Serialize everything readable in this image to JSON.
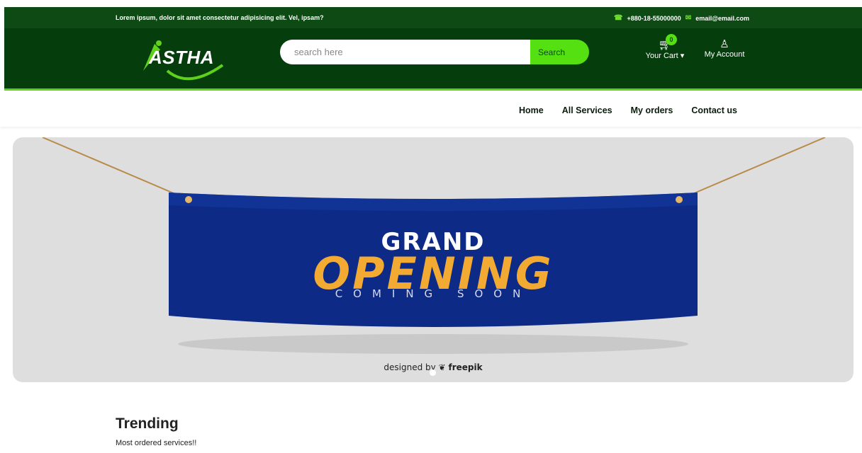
{
  "topbar": {
    "tagline": "Lorem ipsum, dolor sit amet consectetur adipisicing elit. Vel, ipsam?",
    "phone": "+880-18-55000000",
    "email": "email@email.com"
  },
  "header": {
    "logo_text": "ASTHA",
    "search": {
      "placeholder": "search here",
      "button_label": "Search"
    },
    "cart": {
      "count": "0",
      "label": "Your Cart"
    },
    "account": {
      "label": "My Account"
    }
  },
  "nav": {
    "items": [
      {
        "label": "Home"
      },
      {
        "label": "All Services"
      },
      {
        "label": "My orders"
      },
      {
        "label": "Contact us"
      }
    ]
  },
  "banner": {
    "line1": "GRAND",
    "line2": "OPENING",
    "line3": "COMING SOON",
    "credit_prefix": "designed by",
    "credit_brand": "freepik",
    "slide_count": "1",
    "active_slide": "1"
  },
  "trending": {
    "title": "Trending",
    "subtitle": "Most ordered services!!"
  },
  "colors": {
    "topbar": "#0d4a14",
    "header": "#063d0d",
    "accent": "#55e012",
    "banner_blue": "#0c2a86",
    "banner_orange": "#f3aa33"
  }
}
